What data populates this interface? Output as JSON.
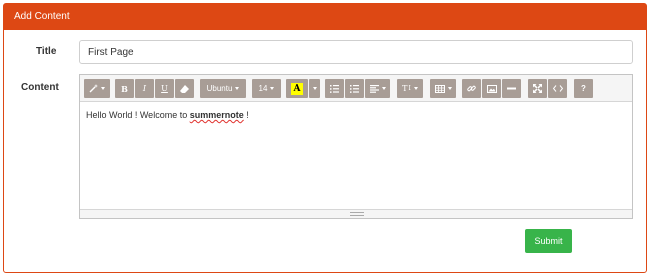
{
  "panel": {
    "heading": "Add Content"
  },
  "form": {
    "title_label": "Title",
    "title_value": "First Page",
    "content_label": "Content",
    "submit_label": "Submit"
  },
  "editor": {
    "toolbar": {
      "bold": "B",
      "italic": "I",
      "underline": "U",
      "font_name": "Ubuntu",
      "font_size": "14",
      "highlight_letter": "A",
      "line_height": "T",
      "help": "?"
    },
    "content": {
      "before": "Hello World ! Welcome to ",
      "misspelled": "summernote",
      "after": " !"
    }
  },
  "colors": {
    "brand": "#dd4814",
    "toolbar_button": "#a89d96",
    "submit": "#38b44a",
    "highlight": "#ffff00"
  },
  "icons": [
    "magic-wand-icon",
    "eraser-icon",
    "unordered-list-icon",
    "ordered-list-icon",
    "align-icon",
    "table-icon",
    "link-icon",
    "image-icon",
    "horizontal-rule-icon",
    "fullscreen-icon",
    "code-view-icon",
    "help-icon",
    "chevron-down-icon"
  ]
}
